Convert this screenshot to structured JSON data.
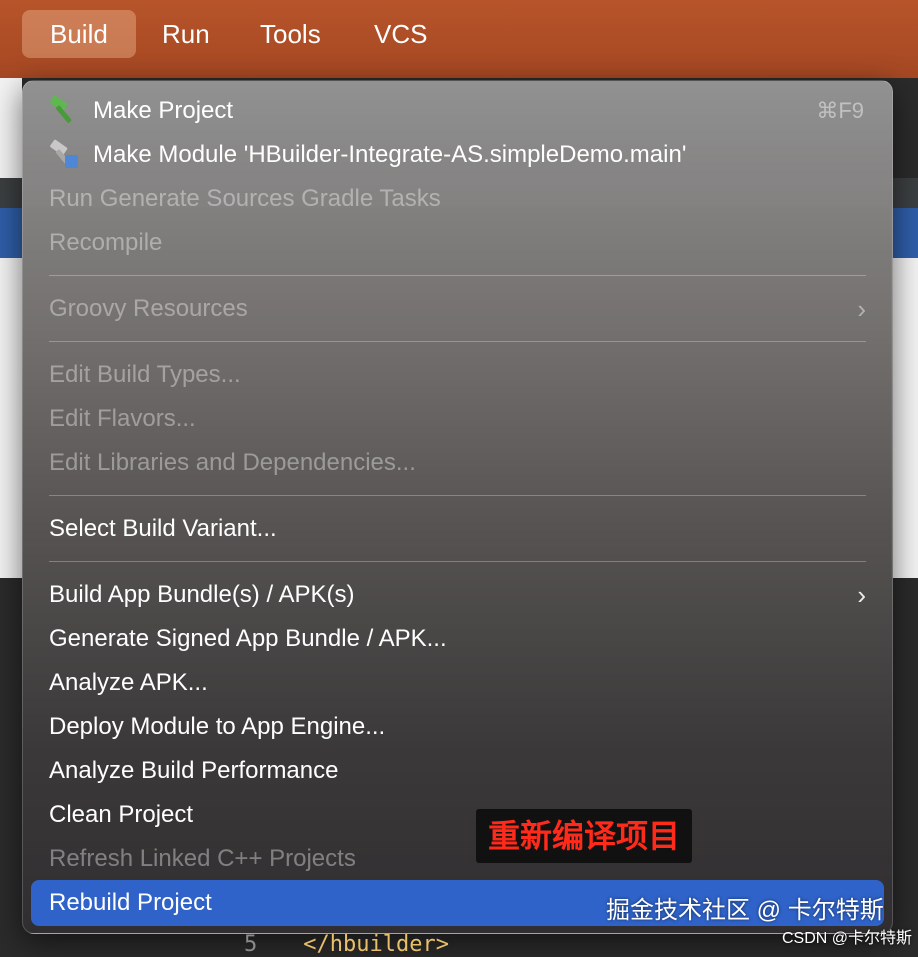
{
  "menubar": {
    "items": [
      {
        "label": "Build",
        "active": true
      },
      {
        "label": "Run"
      },
      {
        "label": "Tools"
      },
      {
        "label": "VCS"
      }
    ]
  },
  "build_menu": {
    "make_project": {
      "label": "Make Project",
      "shortcut": "⌘F9",
      "icon": "hammer-icon"
    },
    "make_module": {
      "label": "Make Module 'HBuilder-Integrate-AS.simpleDemo.main'",
      "icon": "make-module-icon"
    },
    "run_generate_sources": {
      "label": "Run Generate Sources Gradle Tasks",
      "enabled": false
    },
    "recompile": {
      "label": "Recompile",
      "enabled": false
    },
    "groovy_resources": {
      "label": "Groovy Resources",
      "enabled": false,
      "submenu": true
    },
    "edit_build_types": {
      "label": "Edit Build Types...",
      "enabled": false
    },
    "edit_flavors": {
      "label": "Edit Flavors...",
      "enabled": false
    },
    "edit_libraries": {
      "label": "Edit Libraries and Dependencies...",
      "enabled": false
    },
    "select_build_variant": {
      "label": "Select Build Variant..."
    },
    "build_app_bundle": {
      "label": "Build App Bundle(s) / APK(s)",
      "submenu": true
    },
    "generate_signed": {
      "label": "Generate Signed App Bundle / APK..."
    },
    "analyze_apk": {
      "label": "Analyze APK..."
    },
    "deploy_module": {
      "label": "Deploy Module to App Engine..."
    },
    "analyze_build_perf": {
      "label": "Analyze Build Performance"
    },
    "clean_project": {
      "label": "Clean Project"
    },
    "refresh_linked": {
      "label": "Refresh Linked C++ Projects",
      "enabled": false
    },
    "rebuild_project": {
      "label": "Rebuild Project",
      "highlighted": true
    }
  },
  "annotation": {
    "label": "重新编译项目"
  },
  "watermark": {
    "main": "掘金技术社区 @ 卡尔特斯",
    "small": "CSDN @卡尔特斯"
  },
  "code_peek": {
    "line_number": "5",
    "text": "</hbuilder>"
  },
  "colors": {
    "menubar": "#b7542a",
    "highlight": "#2f63c9",
    "annotation_text": "#ff2a1a"
  }
}
